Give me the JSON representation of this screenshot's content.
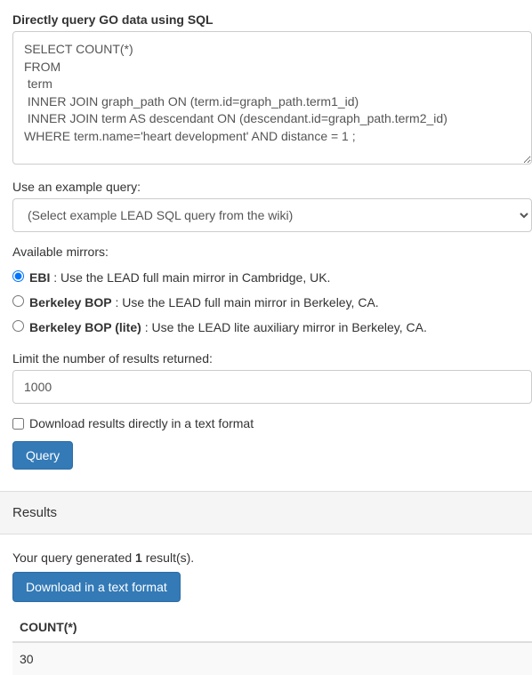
{
  "form": {
    "sql_label": "Directly query GO data using SQL",
    "sql_value": "SELECT COUNT(*)\nFROM\n term\n INNER JOIN graph_path ON (term.id=graph_path.term1_id)\n INNER JOIN term AS descendant ON (descendant.id=graph_path.term2_id)\nWHERE term.name='heart development' AND distance = 1 ;",
    "example_label": "Use an example query:",
    "example_placeholder": "(Select example LEAD SQL query from the wiki)",
    "mirrors_label": "Available mirrors:",
    "mirrors": [
      {
        "name": "EBI",
        "desc": ": Use the LEAD full main mirror in Cambridge, UK.",
        "checked": true
      },
      {
        "name": "Berkeley BOP",
        "desc": ": Use the LEAD full main mirror in Berkeley, CA.",
        "checked": false
      },
      {
        "name": "Berkeley BOP (lite)",
        "desc": ": Use the LEAD lite auxiliary mirror in Berkeley, CA.",
        "checked": false
      }
    ],
    "limit_label": "Limit the number of results returned:",
    "limit_value": "1000",
    "download_checkbox_label": "Download results directly in a text format",
    "query_button": "Query"
  },
  "results": {
    "heading": "Results",
    "generated_prefix": "Your query generated ",
    "generated_count": "1",
    "generated_suffix": " result(s).",
    "download_button": "Download in a text format",
    "columns": [
      "COUNT(*)"
    ],
    "rows": [
      [
        "30"
      ]
    ]
  }
}
